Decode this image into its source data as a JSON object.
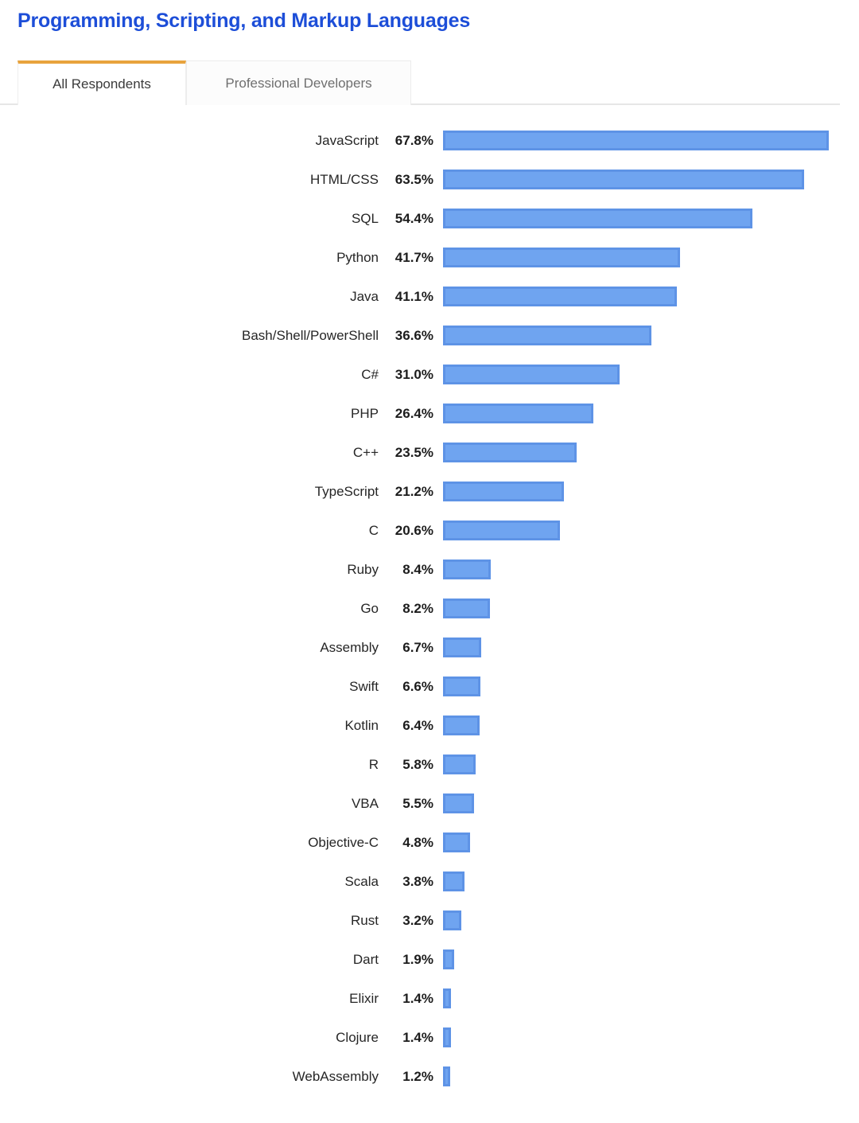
{
  "header": {
    "title": "Programming, Scripting, and Markup Languages"
  },
  "tabs": [
    {
      "label": "All Respondents",
      "active": true
    },
    {
      "label": "Professional Developers",
      "active": false
    }
  ],
  "colors": {
    "title": "#1d4ed8",
    "active_tab_accent": "#e8a33d",
    "bar_fill": "#6fa4f0",
    "bar_border": "#5e93e6"
  },
  "chart_data": {
    "type": "bar",
    "orientation": "horizontal",
    "title": "Programming, Scripting, and Markup Languages",
    "xlabel": "",
    "ylabel": "",
    "xlim": [
      0,
      67.8
    ],
    "grid": false,
    "legend": "none",
    "value_suffix": "%",
    "categories": [
      "JavaScript",
      "HTML/CSS",
      "SQL",
      "Python",
      "Java",
      "Bash/Shell/PowerShell",
      "C#",
      "PHP",
      "C++",
      "TypeScript",
      "C",
      "Ruby",
      "Go",
      "Assembly",
      "Swift",
      "Kotlin",
      "R",
      "VBA",
      "Objective-C",
      "Scala",
      "Rust",
      "Dart",
      "Elixir",
      "Clojure",
      "WebAssembly"
    ],
    "values": [
      67.8,
      63.5,
      54.4,
      41.7,
      41.1,
      36.6,
      31.0,
      26.4,
      23.5,
      21.2,
      20.6,
      8.4,
      8.2,
      6.7,
      6.6,
      6.4,
      5.8,
      5.5,
      4.8,
      3.8,
      3.2,
      1.9,
      1.4,
      1.4,
      1.2
    ],
    "value_labels": [
      "67.8%",
      "63.5%",
      "54.4%",
      "41.7%",
      "41.1%",
      "36.6%",
      "31.0%",
      "26.4%",
      "23.5%",
      "21.2%",
      "20.6%",
      "8.4%",
      "8.2%",
      "6.7%",
      "6.6%",
      "6.4%",
      "5.8%",
      "5.5%",
      "4.8%",
      "3.8%",
      "3.2%",
      "1.9%",
      "1.4%",
      "1.4%",
      "1.2%"
    ]
  }
}
